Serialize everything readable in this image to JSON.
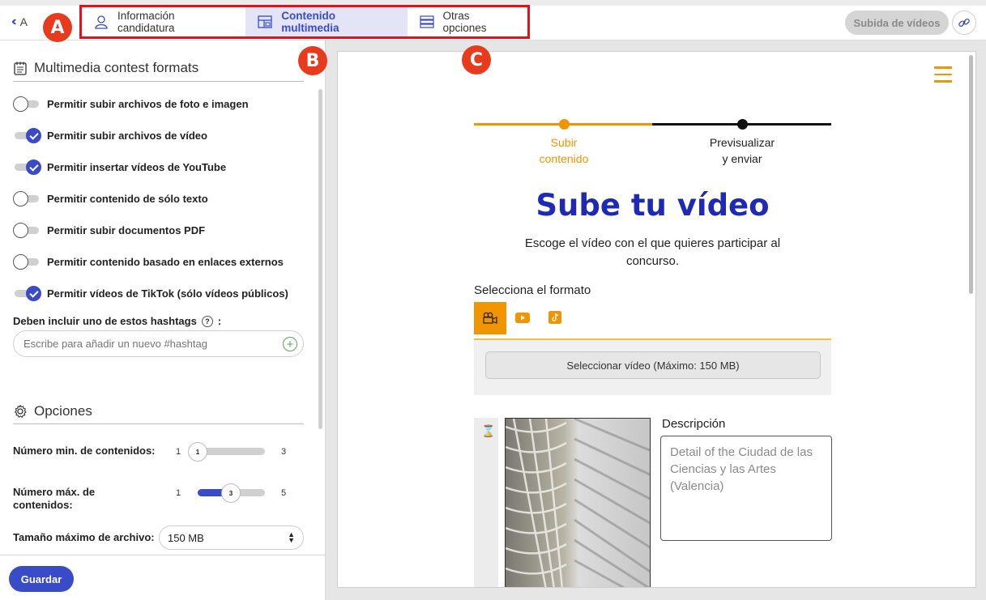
{
  "topbar": {
    "back_label": "A",
    "tabs": [
      {
        "label": "Información candidatura",
        "icon": "user-icon"
      },
      {
        "label": "Contenido multimedia",
        "icon": "layout-icon",
        "active": true
      },
      {
        "label": "Otras opciones",
        "icon": "list-icon"
      }
    ],
    "upload_label": "Subida de vídeos",
    "link_icon": "link-icon"
  },
  "badges": [
    "A",
    "B",
    "C"
  ],
  "left": {
    "formats_title": "Multimedia contest formats",
    "toggles": [
      {
        "label": "Permitir subir archivos de foto e imagen",
        "on": false
      },
      {
        "label": "Permitir subir archivos de vídeo",
        "on": true
      },
      {
        "label": "Permitir insertar vídeos de YouTube",
        "on": true
      },
      {
        "label": "Permitir contenido de sólo texto",
        "on": false
      },
      {
        "label": "Permitir subir documentos PDF",
        "on": false
      },
      {
        "label": "Permitir contenido basado en enlaces externos",
        "on": false
      },
      {
        "label": "Permitir vídeos de TikTok (sólo vídeos públicos)",
        "on": true
      }
    ],
    "hashtag_label": "Deben incluir uno de estos hashtags",
    "hashtag_suffix": ":",
    "hashtag_help": "?",
    "hashtag_placeholder": "Escribe para añadir un nuevo #hashtag",
    "options_title": "Opciones",
    "min_label": "Número min. de contenidos:",
    "min_slider": {
      "min": "1",
      "max": "3",
      "value": "1"
    },
    "max_label_1": "Número máx. de",
    "max_label_2": "contenidos:",
    "max_slider": {
      "min": "1",
      "max": "5",
      "value": "3"
    },
    "size_label": "Tamaño máximo de archivo:",
    "size_value": "150 MB",
    "save_label": "Guardar"
  },
  "preview": {
    "step1_line1": "Subir",
    "step1_line2": "contenido",
    "step2_line1": "Previsualizar",
    "step2_line2": "y enviar",
    "heading": "Sube tu vídeo",
    "subtext": "Escoge el vídeo con el que quieres participar al concurso.",
    "format_label": "Selecciona el formato",
    "select_video": "Seleccionar vídeo",
    "max_size": "(Máximo: 150 MB)",
    "desc_label": "Descripción",
    "desc_value": "Detail of the Ciudad de las Ciencias y las Artes (Valencia)"
  },
  "colors": {
    "accent": "#3a4bc7",
    "orange": "#f09400",
    "heading": "#1e2ab5",
    "badge": "#e83a1c",
    "highlight": "#e3111b"
  }
}
